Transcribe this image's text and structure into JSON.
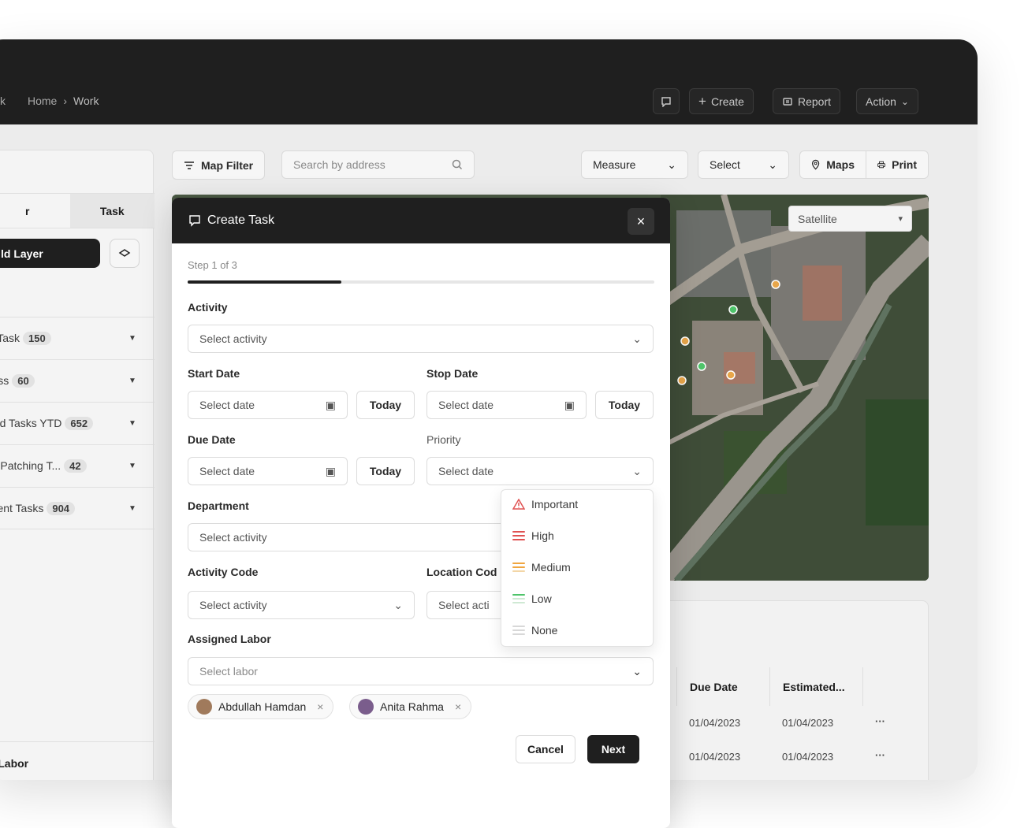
{
  "topbar": {
    "crumb_prev": "k",
    "crumb_home": "Home",
    "crumb_sep": "›",
    "crumb_current": "Work",
    "create_label": "Create",
    "report_label": "Report",
    "action_label": "Action"
  },
  "toolbar": {
    "map_filter_label": "Map Filter",
    "search_placeholder": "Search by address",
    "measure_label": "Measure",
    "select_label": "Select",
    "maps_label": "Maps",
    "print_label": "Print"
  },
  "sidebar": {
    "tab_left": "r",
    "tab_task": "Task",
    "add_layer_label": "ld Layer",
    "items": [
      {
        "label": "ed Task",
        "count": "150"
      },
      {
        "label": "gress",
        "count": "60"
      },
      {
        "label": "leted Tasks YTD",
        "count": "652"
      },
      {
        "label": "ent Patching T...",
        "count": "42"
      },
      {
        "label": "ement Tasks",
        "count": "904"
      }
    ],
    "bottom_label": "ed Labor"
  },
  "map": {
    "layer_select_value": "Satellite",
    "markers": [
      {
        "color": "#e8a64a"
      },
      {
        "color": "#4ec46a"
      },
      {
        "color": "#e8a64a"
      },
      {
        "color": "#4ec46a"
      },
      {
        "color": "#e8a64a"
      },
      {
        "color": "#e8a64a"
      }
    ]
  },
  "table": {
    "headers": [
      "Due Date",
      "Estimated..."
    ],
    "rows": [
      {
        "due": "01/04/2023",
        "estimated": "01/04/2023",
        "more": "···"
      },
      {
        "due": "01/04/2023",
        "estimated": "01/04/2023",
        "more": "···"
      }
    ]
  },
  "modal": {
    "title": "Create Task",
    "step": "Step 1 of 3",
    "progress": 0.33,
    "activity_label": "Activity",
    "activity_placeholder": "Select activity",
    "start_date_label": "Start Date",
    "stop_date_label": "Stop Date",
    "due_date_label": "Due Date",
    "priority_label": "Priority",
    "date_placeholder": "Select date",
    "today_label": "Today",
    "priority_value": "Select date",
    "department_label": "Department",
    "department_placeholder": "Select activity",
    "activity_code_label": "Activity Code",
    "activity_code_placeholder": "Select activity",
    "location_code_label": "Location Cod",
    "location_code_placeholder": "Select acti",
    "assigned_labor_label": "Assigned Labor",
    "labor_placeholder": "Select labor",
    "chips": [
      "Abdullah Hamdan",
      "Anita Rahma"
    ],
    "cancel_label": "Cancel",
    "next_label": "Next"
  },
  "priority_menu": [
    {
      "label": "Important",
      "color": "#e05252"
    },
    {
      "label": "High",
      "color": "#e05252"
    },
    {
      "label": "Medium",
      "color": "#f0a640"
    },
    {
      "label": "Low",
      "color": "#4ec46a"
    },
    {
      "label": "None",
      "color": "#cfcfcf"
    }
  ]
}
